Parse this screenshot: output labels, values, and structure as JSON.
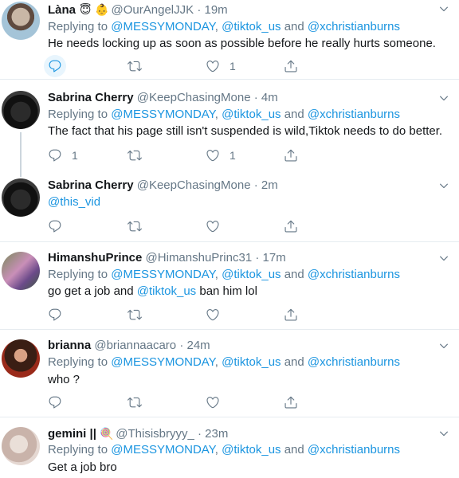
{
  "tweets": [
    {
      "name": "Làna",
      "emojis": [
        "😇",
        "👶"
      ],
      "handle": "@OurAngelJJK",
      "time": "19m",
      "replying_prefix": "Replying to",
      "replying_mentions": [
        "@MESSYMONDAY",
        "@tiktok_us",
        "@xchristianburns"
      ],
      "text": "He needs locking up as soon as possible before he really hurts someone.",
      "reply_count": "",
      "retweet_count": "",
      "like_count": "1"
    },
    {
      "name": "Sabrina Cherry",
      "handle": "@KeepChasingMone",
      "time": "4m",
      "replying_prefix": "Replying to",
      "replying_mentions": [
        "@MESSYMONDAY",
        "@tiktok_us",
        "@xchristianburns"
      ],
      "text": "The fact that his page still isn't suspended is wild,Tiktok needs to do better.",
      "reply_count": "1",
      "retweet_count": "",
      "like_count": "1"
    },
    {
      "name": "Sabrina Cherry",
      "handle": "@KeepChasingMone",
      "time": "2m",
      "text_mention": "@this_vid",
      "reply_count": "",
      "retweet_count": "",
      "like_count": ""
    },
    {
      "name": "HimanshuPrince",
      "handle": "@HimanshuPrinc31",
      "time": "17m",
      "replying_prefix": "Replying to",
      "replying_mentions": [
        "@MESSYMONDAY",
        "@tiktok_us",
        "@xchristianburns"
      ],
      "text_before": "go get a job and",
      "text_mention": "@tiktok_us",
      "text_after": " ban him lol",
      "reply_count": "",
      "retweet_count": "",
      "like_count": ""
    },
    {
      "name": "brianna",
      "handle": "@briannaacaro",
      "time": "24m",
      "replying_prefix": "Replying to",
      "replying_mentions": [
        "@MESSYMONDAY",
        "@tiktok_us",
        "@xchristianburns"
      ],
      "text": "who ?",
      "reply_count": "",
      "retweet_count": "",
      "like_count": ""
    },
    {
      "name": "gemini ||",
      "emojis": [
        "🍭"
      ],
      "handle": "@Thisisbryyy_",
      "time": "23m",
      "replying_prefix": "Replying to",
      "replying_mentions": [
        "@MESSYMONDAY",
        "@tiktok_us",
        "@xchristianburns"
      ],
      "text": "Get a job bro"
    }
  ],
  "separators": {
    "dot": "·",
    "comma": ",",
    "and": "and"
  },
  "colors": {
    "link": "#1b95e0",
    "muted": "#657786",
    "border": "#e6ecf0",
    "reply_highlight": "#e8f5fd"
  },
  "icons": {
    "reply": "reply-icon",
    "retweet": "retweet-icon",
    "like": "heart-icon",
    "share": "share-icon",
    "menu": "chevron-down-icon"
  }
}
